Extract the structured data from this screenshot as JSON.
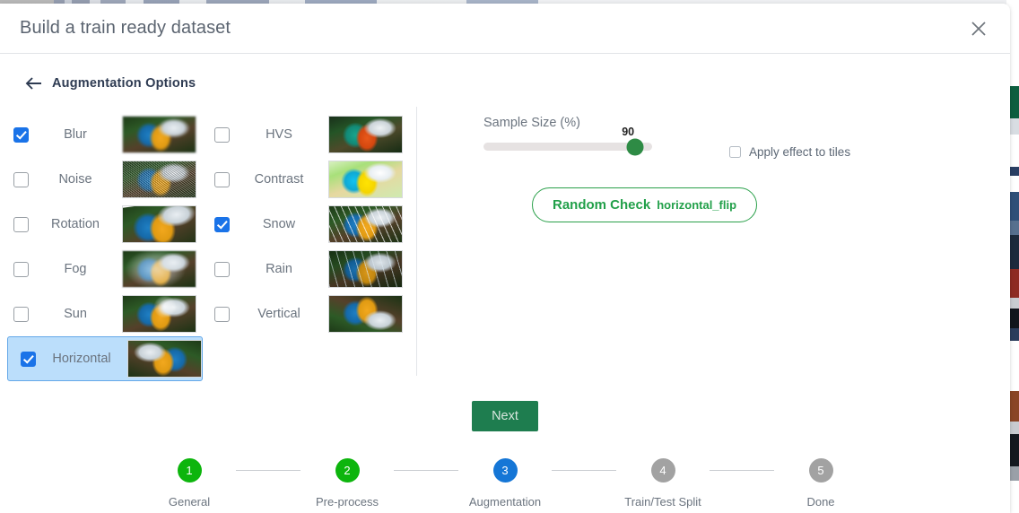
{
  "background": {
    "note": "host page visible behind modal"
  },
  "modal": {
    "title": "Build a train ready dataset",
    "close_icon": "close-icon"
  },
  "section": {
    "back_icon": "arrow-left-icon",
    "title": "Augmentation Options"
  },
  "options": {
    "column_one": [
      {
        "label": "Blur",
        "checked": true,
        "highlighted": false,
        "thumb": "blur-preview"
      },
      {
        "label": "Noise",
        "checked": false,
        "highlighted": false,
        "thumb": "noise-preview"
      },
      {
        "label": "Rotation",
        "checked": false,
        "highlighted": false,
        "thumb": "rotation-preview"
      },
      {
        "label": "Fog",
        "checked": false,
        "highlighted": false,
        "thumb": "fog-preview"
      },
      {
        "label": "Sun",
        "checked": false,
        "highlighted": false,
        "thumb": "sun-preview"
      },
      {
        "label": "Horizontal",
        "checked": true,
        "highlighted": true,
        "thumb": "horizontal-flip-preview"
      }
    ],
    "column_two": [
      {
        "label": "HVS",
        "checked": false,
        "highlighted": false,
        "thumb": "hvs-preview"
      },
      {
        "label": "Contrast",
        "checked": false,
        "highlighted": false,
        "thumb": "contrast-preview"
      },
      {
        "label": "Snow",
        "checked": true,
        "highlighted": false,
        "thumb": "snow-preview"
      },
      {
        "label": "Rain",
        "checked": false,
        "highlighted": false,
        "thumb": "rain-preview"
      },
      {
        "label": "Vertical",
        "checked": false,
        "highlighted": false,
        "thumb": "vertical-flip-preview"
      }
    ]
  },
  "controls": {
    "sample_size_label": "Sample Size (%)",
    "sample_size_value": "90",
    "sample_size_percent": 90,
    "apply_tiles_label": "Apply effect to tiles",
    "apply_tiles_checked": false,
    "random_check_label": "Random Check",
    "random_check_effect": "horizontal_flip"
  },
  "footer": {
    "next_label": "Next"
  },
  "stepper": {
    "steps": [
      {
        "number": "1",
        "label": "General",
        "state": "done"
      },
      {
        "number": "2",
        "label": "Pre-process",
        "state": "done"
      },
      {
        "number": "3",
        "label": "Augmentation",
        "state": "active"
      },
      {
        "number": "4",
        "label": "Train/Test Split",
        "state": "todo"
      },
      {
        "number": "5",
        "label": "Done",
        "state": "todo"
      }
    ]
  },
  "colors": {
    "checkbox_checked": "#1a73e8",
    "highlight_row": "#bbdefb",
    "slider_thumb": "#2e8b45",
    "next_button": "#1e7d4f",
    "random_button": "#22a04a",
    "step_done": "#0db50d",
    "step_active": "#1576d6",
    "step_todo": "#a2a2a2"
  }
}
